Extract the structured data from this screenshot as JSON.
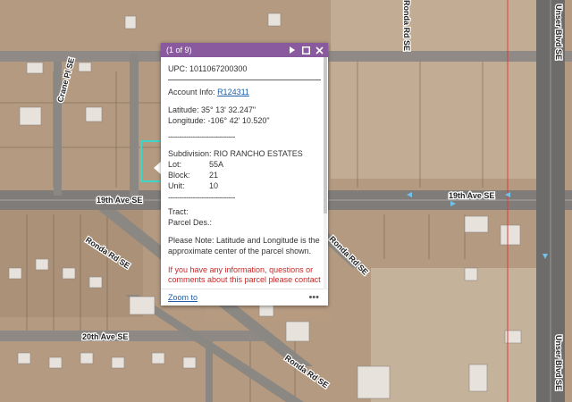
{
  "map": {
    "road_labels": [
      "19th Ave SE",
      "19th Ave SE",
      "Crane Pl SE",
      "Ronda Rd SE",
      "Ronda Rd SE",
      "20th Ave SE",
      "Ronda Rd SE",
      "Unser Blvd SE",
      "Unser Blvd SE",
      "Ronda Rd SE"
    ]
  },
  "popup": {
    "count": "(1 of 9)",
    "upc": "UPC: 1011067200300",
    "account_label": "Account Info:",
    "account_link": "R124311",
    "latitude": "Latitude: 35° 13' 32.247\"",
    "longitude": "Longitude: -106° 42' 10.520\"",
    "dashes": "------------------------------",
    "subdivision": "Subdivision: RIO RANCHO ESTATES",
    "lot_label": "Lot:",
    "lot_value": "55A",
    "block_label": "Block:",
    "block_value": "21",
    "unit_label": "Unit:",
    "unit_value": "10",
    "tract": "Tract:",
    "parcel_des": "Parcel Des.:",
    "note": "Please Note: Latitude and Longitude is the approximate center of the parcel shown.",
    "red_text_1": "If you have any information, questions or",
    "red_text_2": "comments about this parcel please contact",
    "zoom_label": "Zoom to",
    "more_label": "•••"
  },
  "colors": {
    "header": "#8a5a9e",
    "parcel_highlight": "#3ed6c8",
    "link": "#1f5ea8",
    "red_line": "#e23b3b"
  }
}
